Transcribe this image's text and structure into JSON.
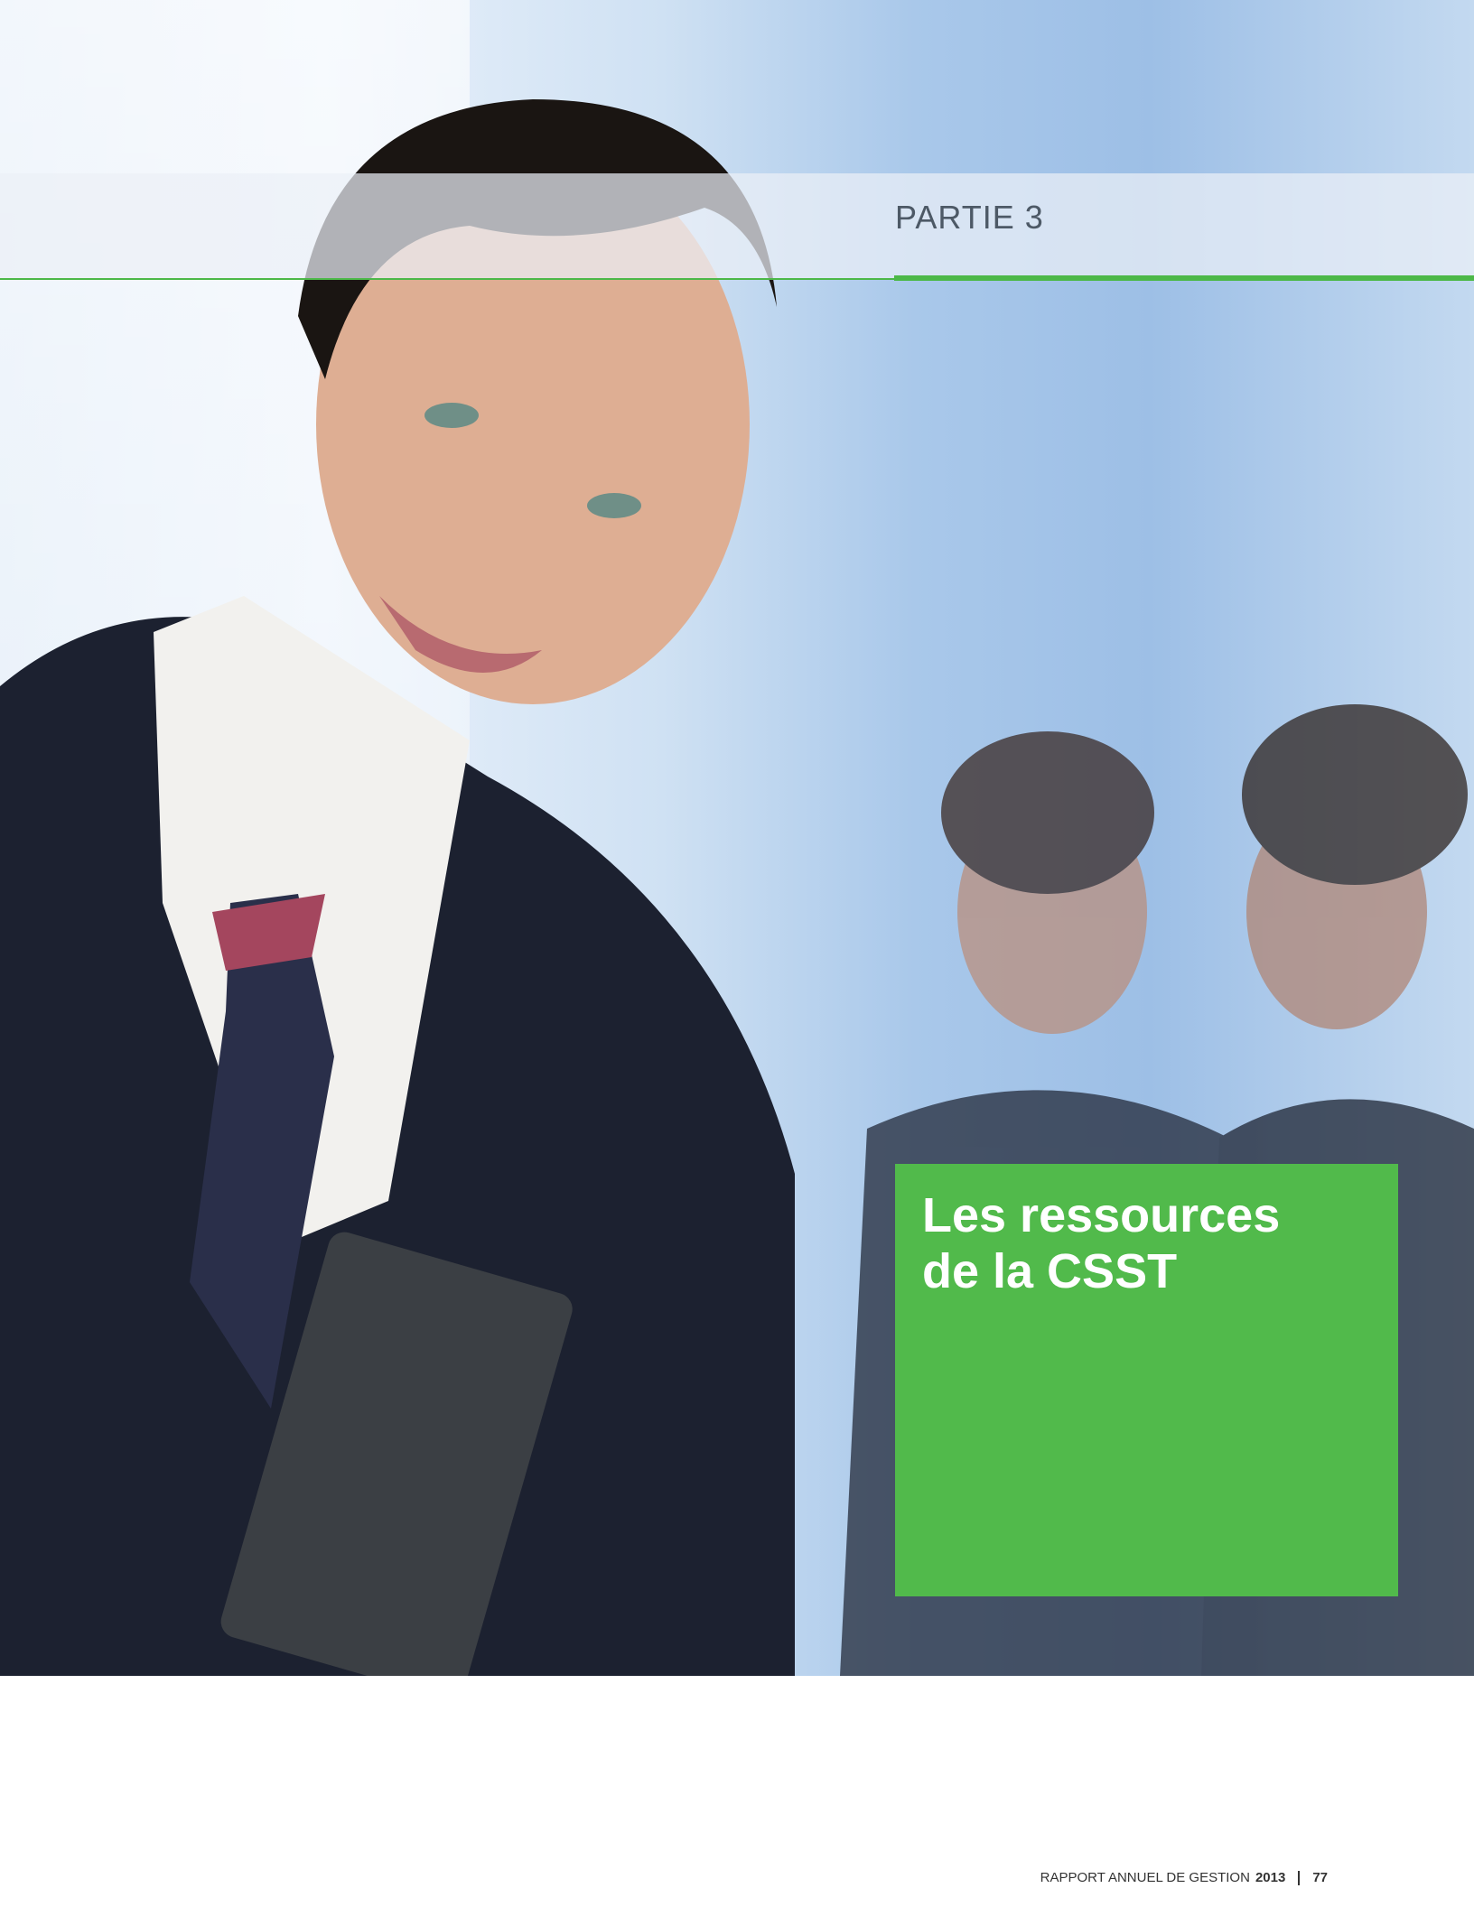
{
  "header": {
    "section_label": "PARTIE 3"
  },
  "title_box": {
    "title": "Les ressources\nde la CSST"
  },
  "footer": {
    "report_name": "RAPPORT ANNUEL DE GESTION",
    "year": "2013",
    "page_number": "77"
  },
  "colors": {
    "accent_green": "#51ba4b",
    "rule_green": "#4cb848",
    "label_gray": "#4d5966"
  }
}
